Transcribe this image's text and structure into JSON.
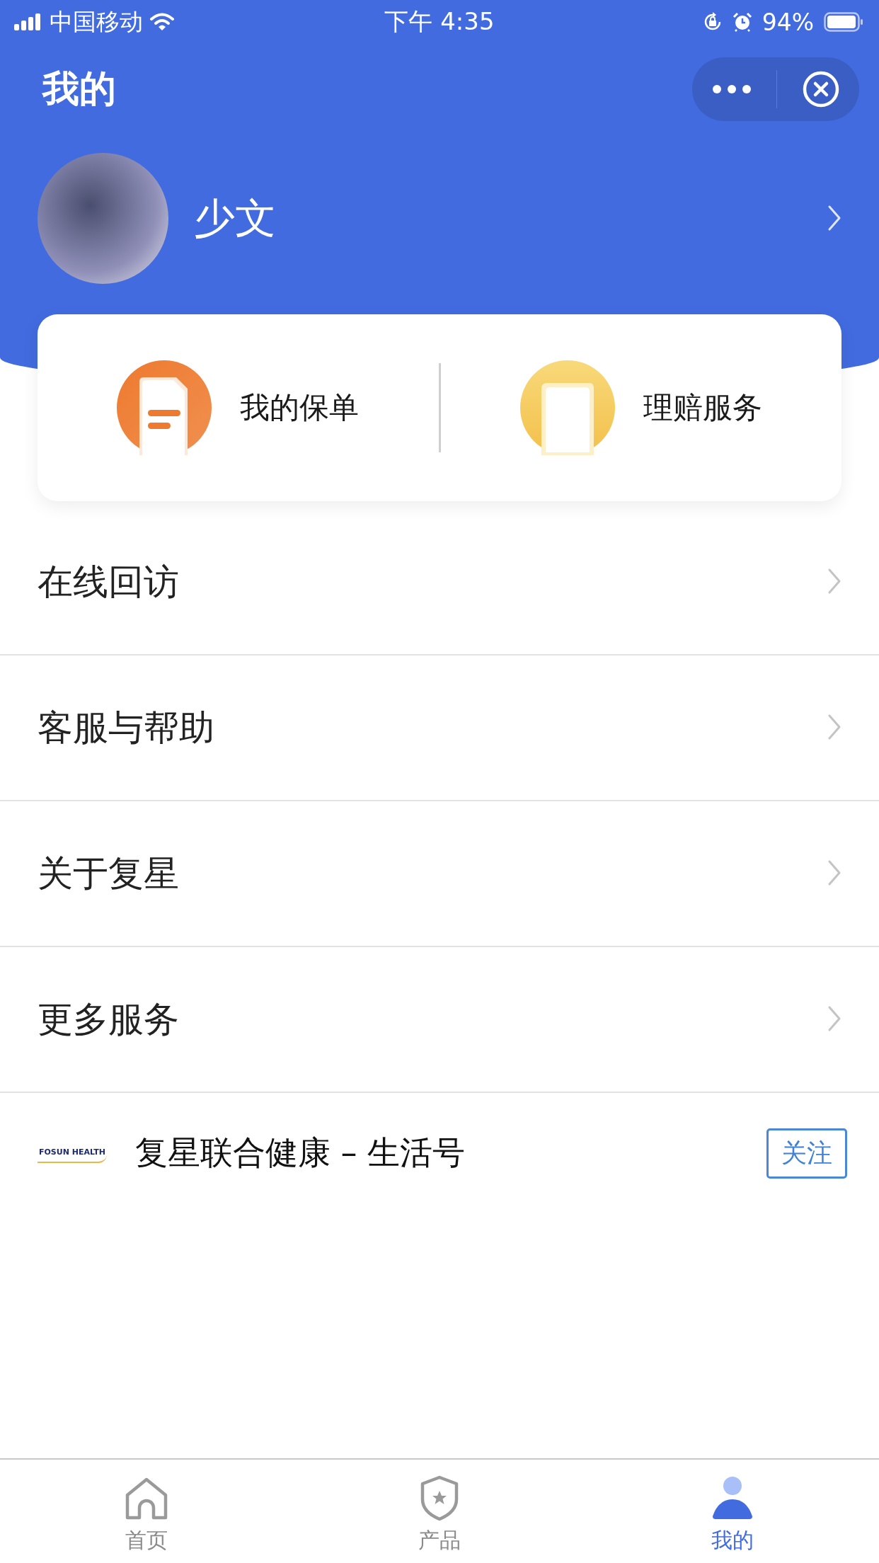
{
  "status_bar": {
    "carrier": "中国移动",
    "time": "下午 4:35",
    "battery": "94%"
  },
  "nav": {
    "title": "我的"
  },
  "profile": {
    "name": "少文"
  },
  "quick_actions": [
    {
      "label": "我的保单",
      "kind": "policy"
    },
    {
      "label": "理赔服务",
      "kind": "claim"
    }
  ],
  "menu": [
    {
      "label": "在线回访"
    },
    {
      "label": "客服与帮助"
    },
    {
      "label": "关于复星"
    },
    {
      "label": "更多服务"
    }
  ],
  "official_account": {
    "logo_text": "FOSUN HEALTH",
    "name": "复星联合健康 – 生活号",
    "follow_label": "关注"
  },
  "tabs": [
    {
      "label": "首页",
      "kind": "home",
      "selected": false
    },
    {
      "label": "产品",
      "kind": "products",
      "selected": false
    },
    {
      "label": "我的",
      "kind": "profile",
      "selected": true
    }
  ]
}
